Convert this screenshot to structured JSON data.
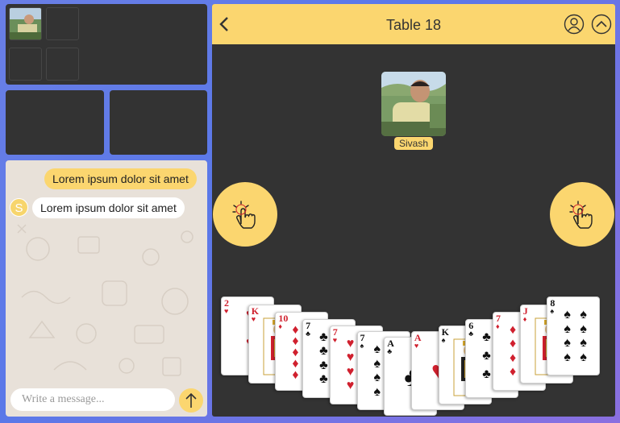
{
  "table": {
    "title": "Table 18"
  },
  "player": {
    "name": "Sivash"
  },
  "chat": {
    "messages": [
      {
        "from": "me",
        "text": "Lorem ipsum dolor sit amet"
      },
      {
        "from": "other",
        "avatar_letter": "S",
        "text": "Lorem ipsum dolor sit amet"
      }
    ],
    "input_placeholder": "Write a message..."
  },
  "hand": [
    {
      "rank": "2",
      "suit": "hearts"
    },
    {
      "rank": "K",
      "suit": "hearts"
    },
    {
      "rank": "10",
      "suit": "diamonds"
    },
    {
      "rank": "7",
      "suit": "clubs"
    },
    {
      "rank": "7",
      "suit": "hearts"
    },
    {
      "rank": "7",
      "suit": "spades"
    },
    {
      "rank": "A",
      "suit": "clubs"
    },
    {
      "rank": "A",
      "suit": "hearts"
    },
    {
      "rank": "K",
      "suit": "spades"
    },
    {
      "rank": "6",
      "suit": "clubs"
    },
    {
      "rank": "7",
      "suit": "diamonds"
    },
    {
      "rank": "J",
      "suit": "diamonds"
    },
    {
      "rank": "8",
      "suit": "spades"
    }
  ],
  "icons": {
    "back": "chevron-left-icon",
    "profile": "user-circle-icon",
    "collapse": "chevron-up-circle-icon",
    "tap": "tap-hand-icon",
    "send": "arrow-up-icon"
  },
  "colors": {
    "accent": "#fbd66f",
    "panel": "#333333",
    "chat_bg": "#e8e1d9"
  }
}
